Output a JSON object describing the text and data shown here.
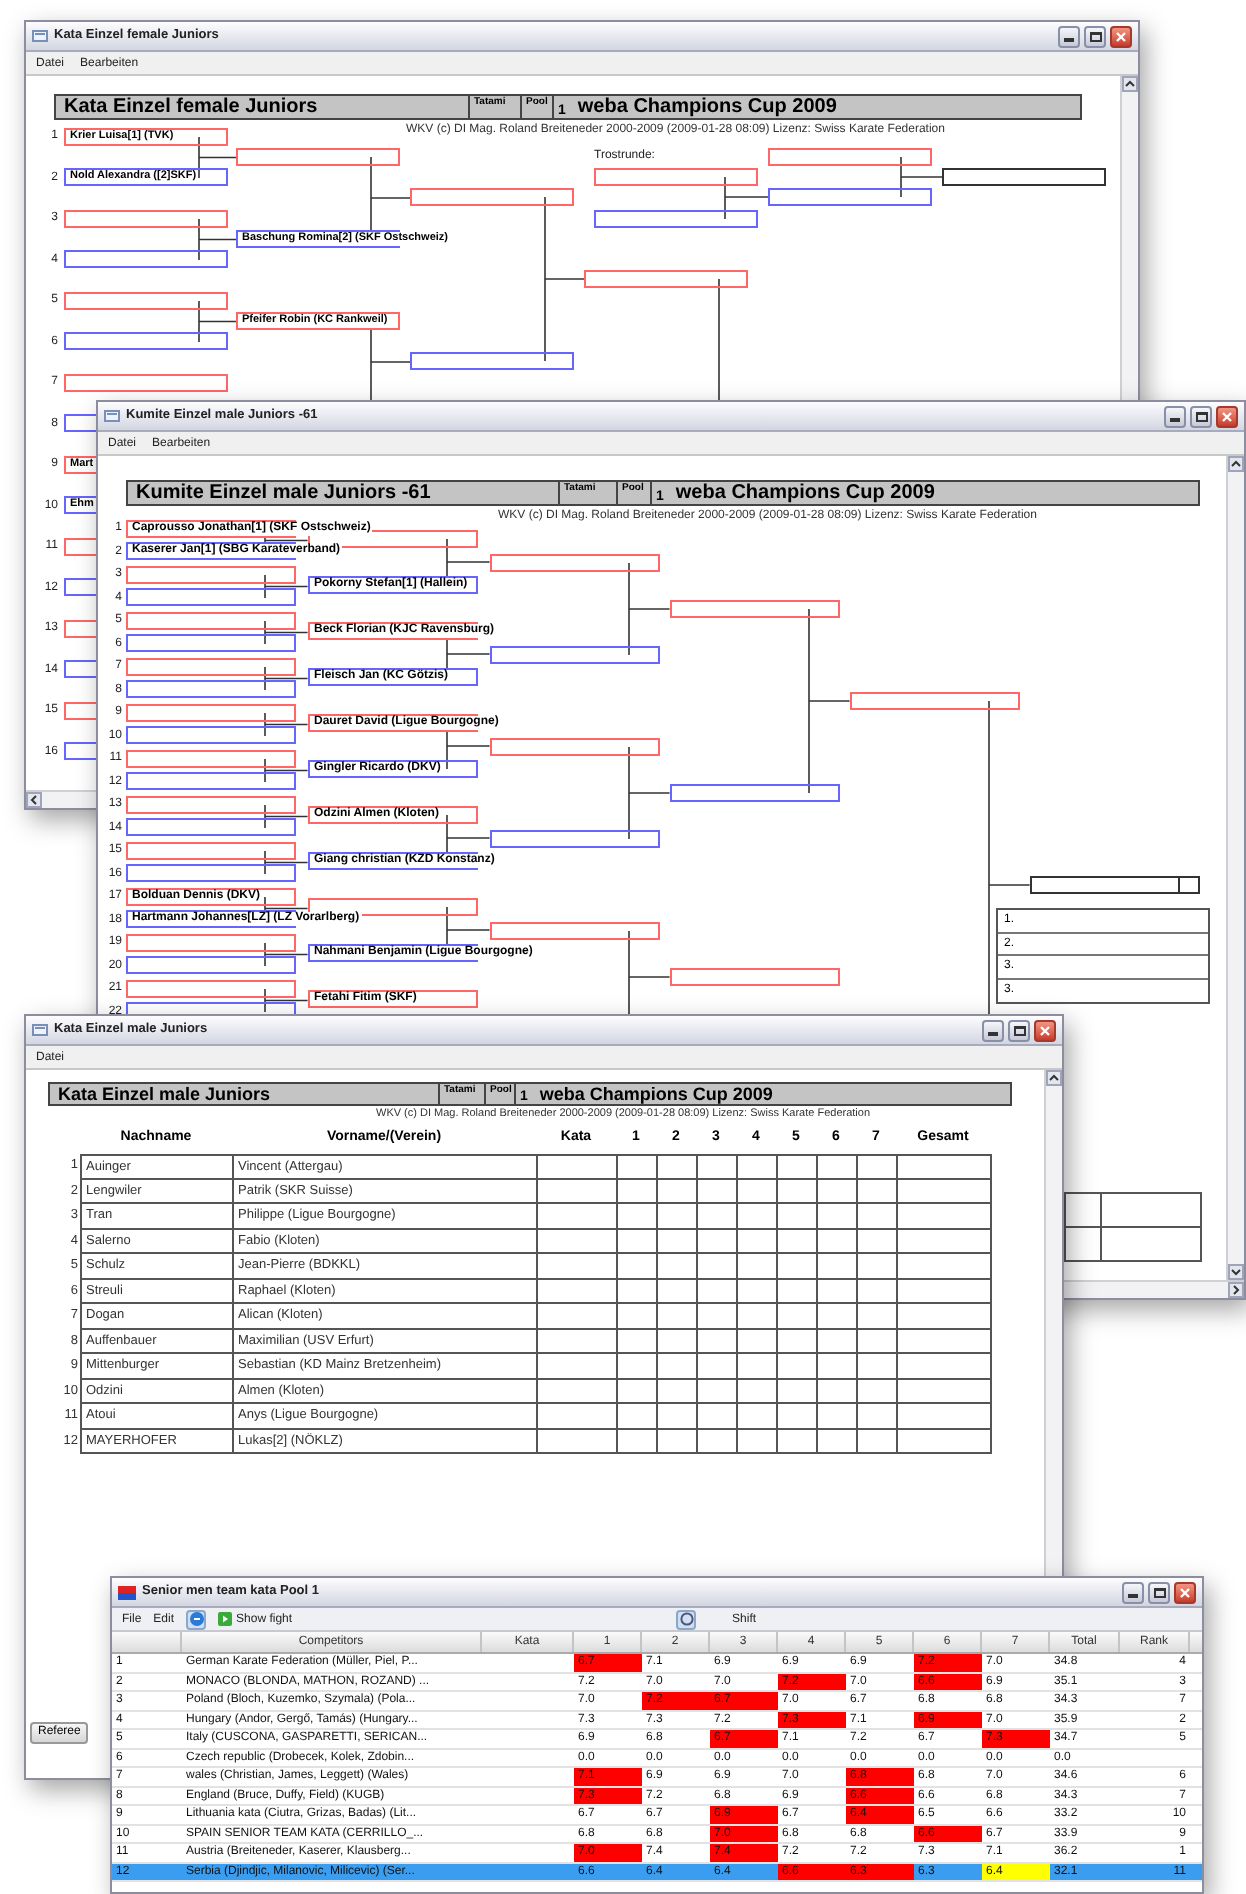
{
  "windows": [
    {
      "kind": "bracket",
      "title": "Kata Einzel female Juniors",
      "menu": [
        "Datei",
        "Bearbeiten"
      ],
      "header": {
        "event": "Kata Einzel female Juniors",
        "tatami_label": "Tatami",
        "pool_label": "Pool",
        "pool": "1",
        "cup": "weba Champions Cup 2009"
      },
      "credit": "WKV (c) DI Mag. Roland Breiteneder 2000-2009 (2009-01-28 08:09)  Lizenz: Swiss Karate Federation",
      "final_score_box": false,
      "rounds": [
        [
          {
            "number": "1",
            "color": "#ff6666",
            "name": "Krier Luisa[1] (TVK)"
          },
          {
            "number": "2",
            "color": "#6666ff",
            "name": "Nold Alexandra ([2]SKF)"
          },
          {
            "number": "3",
            "color": "#ff6666"
          },
          {
            "number": "4",
            "color": "#6666ff"
          },
          {
            "number": "5",
            "color": "#ff6666"
          },
          {
            "number": "6",
            "color": "#6666ff"
          },
          {
            "number": "7",
            "color": "#ff6666"
          },
          {
            "number": "8",
            "color": "#6666ff"
          },
          {
            "number": "9",
            "color": "#ff6666",
            "name": "Mart"
          },
          {
            "number": "10",
            "color": "#6666ff",
            "name": "Ehm"
          },
          {
            "number": "11",
            "color": "#ff6666"
          },
          {
            "number": "12",
            "color": "#6666ff"
          },
          {
            "number": "13",
            "color": "#ff6666"
          },
          {
            "number": "14",
            "color": "#6666ff"
          },
          {
            "number": "15",
            "color": "#ff6666"
          },
          {
            "number": "16",
            "color": "#6666ff"
          }
        ],
        [
          {
            "color": "#ff6666"
          },
          {
            "color": "#6666ff",
            "name": "Baschung Romina[2] (SKF Ostschweiz)"
          },
          {
            "color": "#ff6666",
            "name": "Pfeifer Robin (KC Rankweil)"
          }
        ],
        [
          {
            "color": "#ff6666"
          },
          {
            "color": "#6666ff"
          }
        ],
        [
          {
            "color": "#ff6666"
          }
        ]
      ],
      "consolation": {
        "label": "Trostrunde:",
        "columns": [
          [
            {
              "color": "#ff6666"
            },
            {
              "color": "#6666ff"
            }
          ],
          [
            {
              "color": "#ff6666"
            },
            {
              "color": "#6666ff"
            }
          ],
          [
            {
              "color": "#333333"
            }
          ]
        ]
      }
    },
    {
      "kind": "bracket",
      "title": "Kumite Einzel male Juniors -61",
      "menu": [
        "Datei",
        "Bearbeiten"
      ],
      "header": {
        "event": "Kumite Einzel male Juniors -61",
        "tatami_label": "Tatami",
        "pool_label": "Pool",
        "pool": "1",
        "cup": "weba Champions Cup 2009"
      },
      "credit": "WKV (c) DI Mag. Roland Breiteneder 2000-2009 (2009-01-28 08:09)  Lizenz: Swiss Karate Federation",
      "final_score_box": true,
      "rounds": [
        [
          {
            "number": "1",
            "color": "#ff6666",
            "name": "Caprousso Jonathan[1] (SKF Ostschweiz)"
          },
          {
            "number": "2",
            "color": "#6666ff",
            "name": "Kaserer Jan[1] (SBG Karateverband)"
          },
          {
            "number": "3",
            "color": "#ff6666"
          },
          {
            "number": "4",
            "color": "#6666ff"
          },
          {
            "number": "5",
            "color": "#ff6666"
          },
          {
            "number": "6",
            "color": "#6666ff"
          },
          {
            "number": "7",
            "color": "#ff6666"
          },
          {
            "number": "8",
            "color": "#6666ff"
          },
          {
            "number": "9",
            "color": "#ff6666"
          },
          {
            "number": "10",
            "color": "#6666ff"
          },
          {
            "number": "11",
            "color": "#ff6666"
          },
          {
            "number": "12",
            "color": "#6666ff"
          },
          {
            "number": "13",
            "color": "#ff6666"
          },
          {
            "number": "14",
            "color": "#6666ff"
          },
          {
            "number": "15",
            "color": "#ff6666"
          },
          {
            "number": "16",
            "color": "#6666ff"
          },
          {
            "number": "17",
            "color": "#ff6666",
            "name": "Bolduan Dennis (DKV)"
          },
          {
            "number": "18",
            "color": "#6666ff",
            "name": "Hartmann Johannes[LZ] (LZ Vorarlberg)"
          },
          {
            "number": "19",
            "color": "#ff6666"
          },
          {
            "number": "20",
            "color": "#6666ff"
          },
          {
            "number": "21",
            "color": "#ff6666"
          },
          {
            "number": "22",
            "color": "#6666ff"
          }
        ],
        [
          {
            "color": "#ff6666"
          },
          {
            "color": "#6666ff",
            "name": "Pokorny Stefan[1] (Hallein)"
          },
          {
            "color": "#ff6666",
            "name": "Beck Florian (KJC Ravensburg)"
          },
          {
            "color": "#6666ff",
            "name": "Fleisch Jan (KC Götzis)"
          },
          {
            "color": "#ff6666",
            "name": "Dauret David (Ligue Bourgogne)"
          },
          {
            "color": "#6666ff",
            "name": "Gingler Ricardo (DKV)"
          },
          {
            "color": "#ff6666",
            "name": "Odzini Almen (Kloten)"
          },
          {
            "color": "#6666ff",
            "name": "Giang christian (KZD Konstanz)"
          },
          {
            "color": "#ff6666"
          },
          {
            "color": "#6666ff",
            "name": "Nahmani Benjamin (Ligue Bourgogne)"
          },
          {
            "color": "#ff6666",
            "name": "Fetahi Fitim (SKF)"
          }
        ],
        [
          {
            "color": "#ff6666"
          },
          {
            "color": "#6666ff"
          },
          {
            "color": "#ff6666"
          },
          {
            "color": "#6666ff"
          },
          {
            "color": "#ff6666"
          }
        ],
        [
          {
            "color": "#ff6666"
          },
          {
            "color": "#6666ff"
          },
          {
            "color": "#ff6666"
          }
        ],
        [
          {
            "color": "#ff6666"
          }
        ],
        [
          {
            "color": "#333333"
          }
        ]
      ],
      "places": [
        "1.",
        "2.",
        "3.",
        "3."
      ]
    },
    {
      "kind": "scoresheet",
      "title": "Kata Einzel male Juniors",
      "menu": [
        "Datei"
      ],
      "header": {
        "event": "Kata Einzel male Juniors",
        "tatami_label": "Tatami",
        "pool_label": "Pool",
        "pool": "1",
        "cup": "weba Champions Cup 2009"
      },
      "credit": "WKV (c) DI Mag. Roland Breiteneder 2000-2009 (2009-01-28 08:09)  Lizenz: Swiss Karate Federation",
      "columns": [
        "Nachname",
        "Vorname/(Verein)",
        "Kata",
        "1",
        "2",
        "3",
        "4",
        "5",
        "6",
        "7",
        "Gesamt"
      ],
      "rows": [
        {
          "number": "1",
          "last": "Auinger",
          "first": "Vincent (Attergau)"
        },
        {
          "number": "2",
          "last": "Lengwiler",
          "first": "Patrik (SKR Suisse)"
        },
        {
          "number": "3",
          "last": "Tran",
          "first": "Philippe (Ligue Bourgogne)"
        },
        {
          "number": "4",
          "last": "Salerno",
          "first": "Fabio (Kloten)"
        },
        {
          "number": "5",
          "last": "Schulz",
          "first": "Jean-Pierre (BDKKL)"
        },
        {
          "number": "6",
          "last": "Streuli",
          "first": "Raphael (Kloten)"
        },
        {
          "number": "7",
          "last": "Dogan",
          "first": "Alican (Kloten)"
        },
        {
          "number": "8",
          "last": "Auffenbauer",
          "first": "Maximilian (USV Erfurt)"
        },
        {
          "number": "9",
          "last": "Mittenburger",
          "first": "Sebastian (KD Mainz Bretzenheim)"
        },
        {
          "number": "10",
          "last": "Odzini",
          "first": "Almen (Kloten)"
        },
        {
          "number": "11",
          "last": "Atoui",
          "first": "Anys (Ligue Bourgogne)"
        },
        {
          "number": "12",
          "last": "MAYERHOFER",
          "first": "Lukas[2] (NÖKLZ)"
        }
      ],
      "footer_button": "Referee"
    },
    {
      "kind": "scoreboard",
      "title": "Senior men team kata Pool 1",
      "menu": [
        "File",
        "Edit"
      ],
      "toolbar": {
        "show_fight": "Show fight",
        "shift": "Shift"
      },
      "columns": [
        "Competitors",
        "Kata",
        "1",
        "2",
        "3",
        "4",
        "5",
        "6",
        "7",
        "Total",
        "Rank"
      ],
      "rows": [
        {
          "number": "1",
          "competitor": "German Karate Federation (Müller, Piel, P...",
          "scores": [
            {
              "text": "6.7",
              "color": "#ff0000"
            },
            {
              "text": "7.1"
            },
            {
              "text": "6.9"
            },
            {
              "text": "6.9"
            },
            {
              "text": "6.9"
            },
            {
              "text": "7.2",
              "color": "#ff0000"
            },
            {
              "text": "7.0"
            }
          ],
          "total": "34.8",
          "rank": "4",
          "selected": false
        },
        {
          "number": "2",
          "competitor": "MONACO (BLONDA, MATHON, ROZAND) ...",
          "scores": [
            {
              "text": "7.2"
            },
            {
              "text": "7.0"
            },
            {
              "text": "7.0"
            },
            {
              "text": "7.2",
              "color": "#ff0000"
            },
            {
              "text": "7.0"
            },
            {
              "text": "6.6",
              "color": "#ff0000"
            },
            {
              "text": "6.9"
            }
          ],
          "total": "35.1",
          "rank": "3",
          "selected": false
        },
        {
          "number": "3",
          "competitor": "Poland (Bloch, Kuzemko, Szymala) (Pola...",
          "scores": [
            {
              "text": "7.0"
            },
            {
              "text": "7.2",
              "color": "#ff0000"
            },
            {
              "text": "6.7",
              "color": "#ff0000"
            },
            {
              "text": "7.0"
            },
            {
              "text": "6.7"
            },
            {
              "text": "6.8"
            },
            {
              "text": "6.8"
            }
          ],
          "total": "34.3",
          "rank": "7",
          "selected": false
        },
        {
          "number": "4",
          "competitor": "Hungary (Andor, Gergő, Tamás) (Hungary...",
          "scores": [
            {
              "text": "7.3"
            },
            {
              "text": "7.3"
            },
            {
              "text": "7.2"
            },
            {
              "text": "7.3",
              "color": "#ff0000"
            },
            {
              "text": "7.1"
            },
            {
              "text": "6.9",
              "color": "#ff0000"
            },
            {
              "text": "7.0"
            }
          ],
          "total": "35.9",
          "rank": "2",
          "selected": false
        },
        {
          "number": "5",
          "competitor": "Italy (CUSCONA, GASPARETTI, SERICAN...",
          "scores": [
            {
              "text": "6.9"
            },
            {
              "text": "6.8"
            },
            {
              "text": "6.7",
              "color": "#ff0000"
            },
            {
              "text": "7.1"
            },
            {
              "text": "7.2"
            },
            {
              "text": "6.7"
            },
            {
              "text": "7.3",
              "color": "#ff0000"
            }
          ],
          "total": "34.7",
          "rank": "5",
          "selected": false
        },
        {
          "number": "6",
          "competitor": "Czech republic (Drobecek, Kolek, Zdobin...",
          "scores": [
            {
              "text": "0.0"
            },
            {
              "text": "0.0"
            },
            {
              "text": "0.0"
            },
            {
              "text": "0.0"
            },
            {
              "text": "0.0"
            },
            {
              "text": "0.0"
            },
            {
              "text": "0.0"
            }
          ],
          "total": "0.0",
          "selected": false
        },
        {
          "number": "7",
          "competitor": "wales (Christian, James, Leggett) (Wales)",
          "scores": [
            {
              "text": "7.1",
              "color": "#ff0000"
            },
            {
              "text": "6.9"
            },
            {
              "text": "6.9"
            },
            {
              "text": "7.0"
            },
            {
              "text": "6.8",
              "color": "#ff0000"
            },
            {
              "text": "6.8"
            },
            {
              "text": "7.0"
            }
          ],
          "total": "34.6",
          "rank": "6",
          "selected": false
        },
        {
          "number": "8",
          "competitor": "England (Bruce, Duffy, Field) (KUGB)",
          "scores": [
            {
              "text": "7.3",
              "color": "#ff0000"
            },
            {
              "text": "7.2"
            },
            {
              "text": "6.8"
            },
            {
              "text": "6.9"
            },
            {
              "text": "6.6",
              "color": "#ff0000"
            },
            {
              "text": "6.6"
            },
            {
              "text": "6.8"
            }
          ],
          "total": "34.3",
          "rank": "7",
          "selected": false
        },
        {
          "number": "9",
          "competitor": "Lithuania kata (Ciutra, Grizas, Badas) (Lit...",
          "scores": [
            {
              "text": "6.7"
            },
            {
              "text": "6.7"
            },
            {
              "text": "6.9",
              "color": "#ff0000"
            },
            {
              "text": "6.7"
            },
            {
              "text": "6.4",
              "color": "#ff0000"
            },
            {
              "text": "6.5"
            },
            {
              "text": "6.6"
            }
          ],
          "total": "33.2",
          "rank": "10",
          "selected": false
        },
        {
          "number": "10",
          "competitor": "SPAIN SENIOR TEAM KATA (CERRILLO_...",
          "scores": [
            {
              "text": "6.8"
            },
            {
              "text": "6.8"
            },
            {
              "text": "7.0",
              "color": "#ff0000"
            },
            {
              "text": "6.8"
            },
            {
              "text": "6.8"
            },
            {
              "text": "6.6",
              "color": "#ff0000"
            },
            {
              "text": "6.7"
            }
          ],
          "total": "33.9",
          "rank": "9",
          "selected": false
        },
        {
          "number": "11",
          "competitor": "Austria (Breiteneder, Kaserer, Klausberg...",
          "scores": [
            {
              "text": "7.0",
              "color": "#ff0000"
            },
            {
              "text": "7.4"
            },
            {
              "text": "7.4",
              "color": "#ff0000"
            },
            {
              "text": "7.2"
            },
            {
              "text": "7.2"
            },
            {
              "text": "7.3"
            },
            {
              "text": "7.1"
            }
          ],
          "total": "36.2",
          "rank": "1",
          "selected": false
        },
        {
          "number": "12",
          "competitor": "Serbia  (Djindjic, Milanovic, Milicevic) (Ser...",
          "scores": [
            {
              "text": "6.6"
            },
            {
              "text": "6.4"
            },
            {
              "text": "6.4"
            },
            {
              "text": "6.6",
              "color": "#ff0000"
            },
            {
              "text": "6.3",
              "color": "#ff0000"
            },
            {
              "text": "6.3"
            },
            {
              "text": "6.4",
              "color": "#ffff00"
            }
          ],
          "total": "32.1",
          "rank": "11",
          "selected": true
        }
      ]
    }
  ]
}
